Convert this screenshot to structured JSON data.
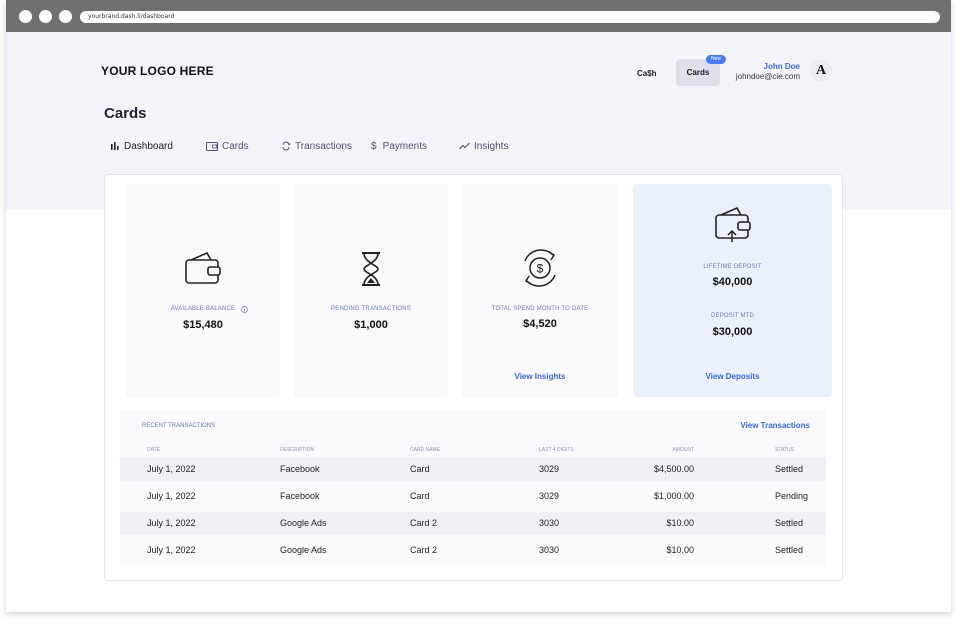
{
  "browser": {
    "url": "yourbrand.dash.li/dashboard"
  },
  "header": {
    "logo": "YOUR LOGO HERE",
    "links": {
      "cash": "Ca$h",
      "cards": "Cards"
    },
    "badge": "New",
    "user": {
      "name": "John Doe",
      "email": "johndoe@cie.com",
      "avatar": "A"
    }
  },
  "page": {
    "title": "Cards"
  },
  "nav": [
    "Dashboard",
    "Cards",
    "Transactions",
    "Payments",
    "Insights"
  ],
  "cards": {
    "available": {
      "label": "AVAILABLE BALANCE",
      "value": "$15,480"
    },
    "pending": {
      "label": "PENDING TRANSACTIONS",
      "value": "$1,000"
    },
    "spend": {
      "label": "TOTAL SPEND MONTH TO DATE",
      "value": "$4,520",
      "link": "View Insights"
    },
    "deposit": {
      "lifetime_label": "LIFETIME DEPOSIT",
      "lifetime_value": "$40,000",
      "mtd_label": "DEPOSIT MTD",
      "mtd_value": "$30,000",
      "link": "View Deposits"
    }
  },
  "transactions": {
    "title": "RECENT TRANSACTIONS",
    "view_link": "View Transactions",
    "columns": [
      "DATE",
      "DESCRIPTION",
      "CARD NAME",
      "LAST 4 DIGITS",
      "AMOUNT",
      "STATUS"
    ],
    "rows": [
      [
        "July 1, 2022",
        "Facebook",
        "Card",
        "3029",
        "$4,500.00",
        "Settled"
      ],
      [
        "July 1, 2022",
        "Facebook",
        "Card",
        "3029",
        "$1,000.00",
        "Pending"
      ],
      [
        "July 1, 2022",
        "Google Ads",
        "Card 2",
        "3030",
        "$10.00",
        "Settled"
      ],
      [
        "July 1, 2022",
        "Google Ads",
        "Card 2",
        "3030",
        "$10.00",
        "Settled"
      ]
    ]
  },
  "colors": {
    "accent": "#3a66d6",
    "badge": "#4a7cf0",
    "highlight_card": "#eaf1fc"
  }
}
